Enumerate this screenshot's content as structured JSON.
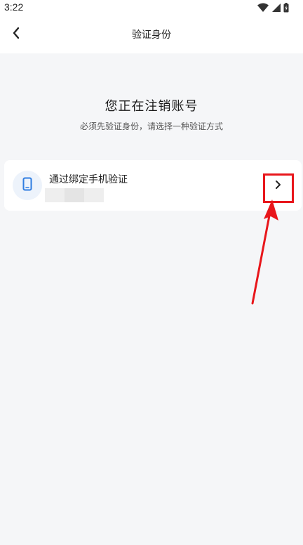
{
  "status_bar": {
    "time": "3:22",
    "icons": [
      "wifi-icon",
      "signal-icon",
      "battery-icon"
    ]
  },
  "nav": {
    "title": "验证身份",
    "back_icon": "chevron-left-icon"
  },
  "main": {
    "heading": "您正在注销账号",
    "subheading": "必须先验证身份，请选择一种验证方式"
  },
  "verification_option": {
    "title": "通过绑定手机验证",
    "icon": "phone-icon",
    "action_icon": "chevron-right-icon"
  },
  "colors": {
    "accent_blue": "#2f7de1",
    "annotation_red": "#e8161b",
    "page_background": "#f5f6f8"
  }
}
